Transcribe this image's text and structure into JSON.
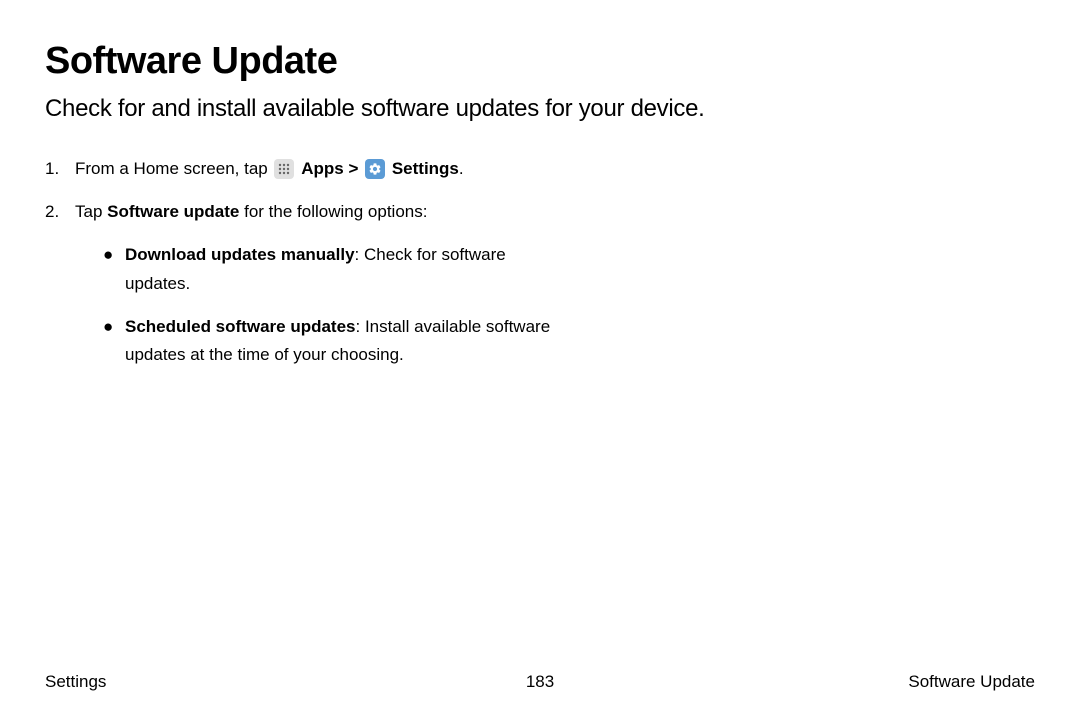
{
  "title": "Software Update",
  "subtitle": "Check for and install available software updates for your device.",
  "steps": {
    "one": {
      "num": "1.",
      "lead": "From a Home screen, tap ",
      "apps": "Apps",
      "arrow": " > ",
      "settings": "Settings",
      "end": "."
    },
    "two": {
      "num": "2.",
      "lead": "Tap ",
      "bold": "Software update",
      "tail": " for the following options:"
    }
  },
  "bullets": {
    "b1": {
      "bold": "Download updates manually",
      "text": ": Check for software updates."
    },
    "b2": {
      "bold": "Scheduled software updates",
      "text": ": Install available software updates at the time of your choosing."
    }
  },
  "footer": {
    "left": "Settings",
    "center": "183",
    "right": "Software Update"
  }
}
